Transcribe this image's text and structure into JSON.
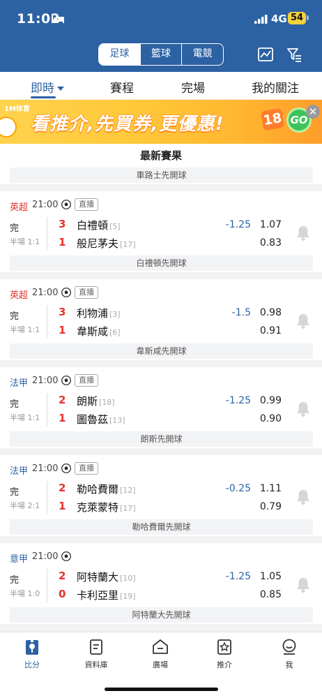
{
  "status_bar": {
    "time": "11:02",
    "network": "4G",
    "battery": "54"
  },
  "sport_tabs": [
    {
      "label": "足球",
      "active": true
    },
    {
      "label": "籃球",
      "active": false
    },
    {
      "label": "電競",
      "active": false
    }
  ],
  "nav_tabs": [
    {
      "label": "即時",
      "active": true
    },
    {
      "label": "賽程",
      "active": false
    },
    {
      "label": "完場",
      "active": false
    },
    {
      "label": "我的關注",
      "active": false
    }
  ],
  "banner": {
    "logo": "1M体育",
    "text": "看推介,先買券,更優惠!",
    "badge": "18",
    "go": "GO"
  },
  "section_title": "最新賽果",
  "first_strip": "車路士先開球",
  "matches": [
    {
      "league": "英超",
      "league_color": "#e6322e",
      "time": "21:00",
      "live_tag": "直播",
      "status": "完",
      "half": "半場 1:1",
      "home": {
        "score": "3",
        "name": "白禮頓",
        "rank": "[5]"
      },
      "away": {
        "score": "1",
        "name": "般尼茅夫",
        "rank": "[17]"
      },
      "handicap": "-1.25",
      "odd_home": "1.07",
      "odd_away": "0.83",
      "kickoff_note": "白禮頓先開球"
    },
    {
      "league": "英超",
      "league_color": "#e6322e",
      "time": "21:00",
      "live_tag": "直播",
      "status": "完",
      "half": "半場 1:1",
      "home": {
        "score": "3",
        "name": "利物浦",
        "rank": "[3]"
      },
      "away": {
        "score": "1",
        "name": "韋斯咸",
        "rank": "[6]"
      },
      "handicap": "-1.5",
      "odd_home": "0.98",
      "odd_away": "0.91",
      "kickoff_note": "韋斯咸先開球"
    },
    {
      "league": "法甲",
      "league_color": "#2c61a3",
      "time": "21:00",
      "live_tag": "直播",
      "status": "完",
      "half": "半場 1:1",
      "home": {
        "score": "2",
        "name": "朗斯",
        "rank": "[18]"
      },
      "away": {
        "score": "1",
        "name": "圖魯茲",
        "rank": "[13]"
      },
      "handicap": "-1.25",
      "odd_home": "0.99",
      "odd_away": "0.90",
      "kickoff_note": "朗斯先開球"
    },
    {
      "league": "法甲",
      "league_color": "#2c61a3",
      "time": "21:00",
      "live_tag": "直播",
      "status": "完",
      "half": "半場 2:1",
      "home": {
        "score": "2",
        "name": "勒哈費爾",
        "rank": "[12]"
      },
      "away": {
        "score": "1",
        "name": "克萊蒙特",
        "rank": "[17]"
      },
      "handicap": "-0.25",
      "odd_home": "1.11",
      "odd_away": "0.79",
      "kickoff_note": "勒哈費爾先開球"
    },
    {
      "league": "意甲",
      "league_color": "#2c61a3",
      "time": "21:00",
      "live_tag": "",
      "status": "完",
      "half": "半場 1:0",
      "home": {
        "score": "2",
        "name": "阿特蘭大",
        "rank": "[10]"
      },
      "away": {
        "score": "0",
        "name": "卡利亞里",
        "rank": "[19]"
      },
      "handicap": "-1.25",
      "odd_home": "1.05",
      "odd_away": "0.85",
      "kickoff_note": "阿特蘭大先開球"
    }
  ],
  "bottom_nav": [
    {
      "label": "比分",
      "icon": "scoreboard-icon",
      "active": true
    },
    {
      "label": "資料庫",
      "icon": "document-icon",
      "active": false
    },
    {
      "label": "廣場",
      "icon": "square-icon",
      "active": false
    },
    {
      "label": "推介",
      "icon": "star-icon",
      "active": false
    },
    {
      "label": "我",
      "icon": "profile-icon",
      "active": false
    }
  ],
  "colors": {
    "brand": "#2c61a3",
    "score_red": "#e6322e"
  }
}
